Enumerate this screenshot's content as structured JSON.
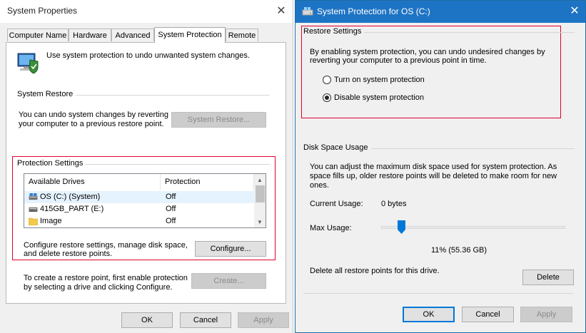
{
  "left_dialog": {
    "title": "System Properties",
    "tabs": [
      {
        "label": "Computer Name"
      },
      {
        "label": "Hardware"
      },
      {
        "label": "Advanced"
      },
      {
        "label": "System Protection",
        "active": true
      },
      {
        "label": "Remote"
      }
    ],
    "intro_text": "Use system protection to undo unwanted system changes.",
    "system_restore": {
      "group_label": "System Restore",
      "description_line1": "You can undo system changes by reverting",
      "description_line2": "your computer to a previous restore point.",
      "button_label": "System Restore..."
    },
    "protection_settings": {
      "group_label": "Protection Settings",
      "columns": [
        "Available Drives",
        "Protection"
      ],
      "drives": [
        {
          "name": "OS (C:) (System)",
          "protection": "Off",
          "icon": "system-drive-icon"
        },
        {
          "name": "415GB_PART (E:)",
          "protection": "Off",
          "icon": "drive-icon"
        },
        {
          "name": "Image",
          "protection": "Off",
          "icon": "folder-icon"
        }
      ],
      "configure_text_line1": "Configure restore settings, manage disk space,",
      "configure_text_line2": "and delete restore points.",
      "configure_button": "Configure...",
      "create_text_line1": "To create a restore point, first enable protection",
      "create_text_line2": "by selecting a drive and clicking Configure.",
      "create_button": "Create..."
    },
    "footer": {
      "ok": "OK",
      "cancel": "Cancel",
      "apply": "Apply"
    }
  },
  "right_dialog": {
    "title": "System Protection for OS (C:)",
    "restore_settings": {
      "group_label": "Restore Settings",
      "description_line1": "By enabling system protection, you can undo undesired changes by",
      "description_line2": "reverting your computer to a previous point in time.",
      "options": [
        {
          "label": "Turn on system protection",
          "selected": false
        },
        {
          "label": "Disable system protection",
          "selected": true
        }
      ]
    },
    "disk_space": {
      "group_label": "Disk Space Usage",
      "description_line1": "You can adjust the maximum disk space used for system protection. As",
      "description_line2": "space fills up, older restore points will be deleted to make room for new",
      "description_line3": "ones.",
      "current_usage_label": "Current Usage:",
      "current_usage_value": "0 bytes",
      "max_usage_label": "Max Usage:",
      "max_usage_percent": 11,
      "max_usage_value": "11% (55.36 GB)",
      "delete_text": "Delete all restore points for this drive.",
      "delete_button": "Delete"
    },
    "footer": {
      "ok": "OK",
      "cancel": "Cancel",
      "apply": "Apply"
    }
  },
  "colors": {
    "accent": "#0078d7",
    "titlebar": "#1e74c4",
    "highlight_box": "#e0002a"
  }
}
